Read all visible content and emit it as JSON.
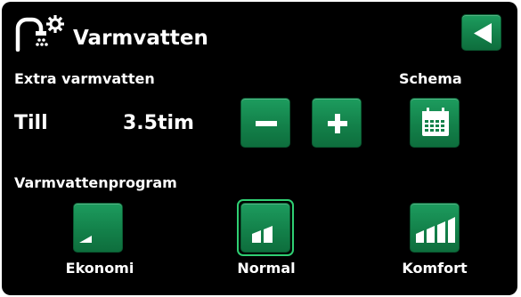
{
  "header": {
    "title": "Varmvatten",
    "icon": "hot-water-tap-icon",
    "back_icon": "back-arrow-icon"
  },
  "extra_hot_water": {
    "label": "Extra varmvatten",
    "state": "Till",
    "duration": "3.5tim",
    "decrease_icon": "minus-icon",
    "increase_icon": "plus-icon"
  },
  "schedule": {
    "label": "Schema",
    "icon": "calendar-icon"
  },
  "program": {
    "label": "Varmvattenprogram",
    "modes": [
      {
        "label": "Ekonomi",
        "icon": "signal-bars-1-icon",
        "selected": false
      },
      {
        "label": "Normal",
        "icon": "signal-bars-2-icon",
        "selected": true
      },
      {
        "label": "Komfort",
        "icon": "signal-bars-3-icon",
        "selected": false
      }
    ]
  },
  "colors": {
    "background": "#000000",
    "button_green": "#13814a",
    "selected_outline": "#2fcf73",
    "text": "#ffffff"
  }
}
